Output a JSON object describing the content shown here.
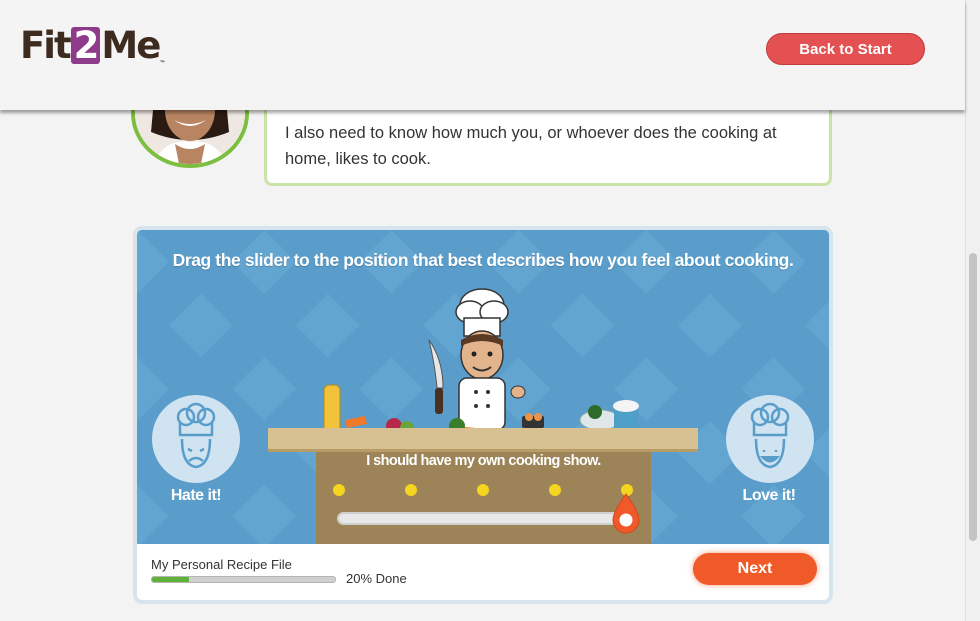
{
  "header": {
    "logo_left": "Fit",
    "logo_mid": "2",
    "logo_right": "Me",
    "logo_mark": "™",
    "back_button": "Back to Start"
  },
  "speech": {
    "text": "I also need to know how much you, or whoever does the cooking at home, likes to cook."
  },
  "activity": {
    "instruction": "Drag the slider to the position that best describes how you feel about cooking.",
    "left_label": "Hate it!",
    "right_label": "Love it!",
    "selected_caption": "I should have my own cooking show.",
    "slider_positions": 5,
    "slider_value": 5
  },
  "footer": {
    "progress_label": "My Personal Recipe File",
    "progress_text": "20% Done",
    "progress_fraction": 0.2,
    "next_button": "Next"
  },
  "colors": {
    "accent_red": "#e35152",
    "accent_orange": "#f05a28",
    "scene_blue": "#5a9dcb",
    "progress_green": "#5fb33a",
    "brand_purple": "#8e3b8b"
  },
  "icons": [
    "chef-hat-sad-icon",
    "chef-hat-happy-icon",
    "slider-drop-handle-icon"
  ]
}
